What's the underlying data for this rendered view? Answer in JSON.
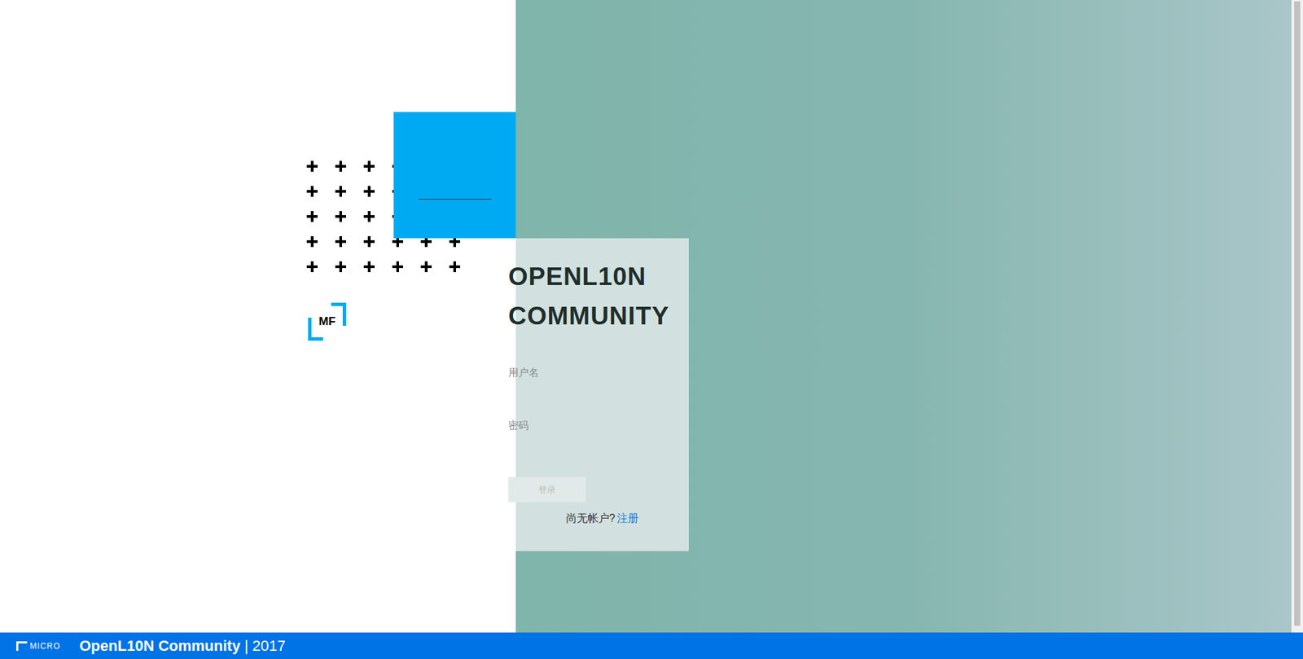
{
  "brand": {
    "logo": "MF"
  },
  "login": {
    "title": "OPENL10N COMMUNITY",
    "fields": [
      {
        "label": "用户名",
        "value": "",
        "kind": "text"
      },
      {
        "label": "密码",
        "value": "",
        "kind": "password"
      }
    ],
    "button": {
      "label": "登录",
      "disabled": true
    },
    "signup": {
      "prompt": "尚无帐户?",
      "link": "注册"
    }
  },
  "footer": {
    "logo": "MICRO",
    "title": "OpenL10N Community",
    "separator": "|",
    "year": "2017"
  }
}
